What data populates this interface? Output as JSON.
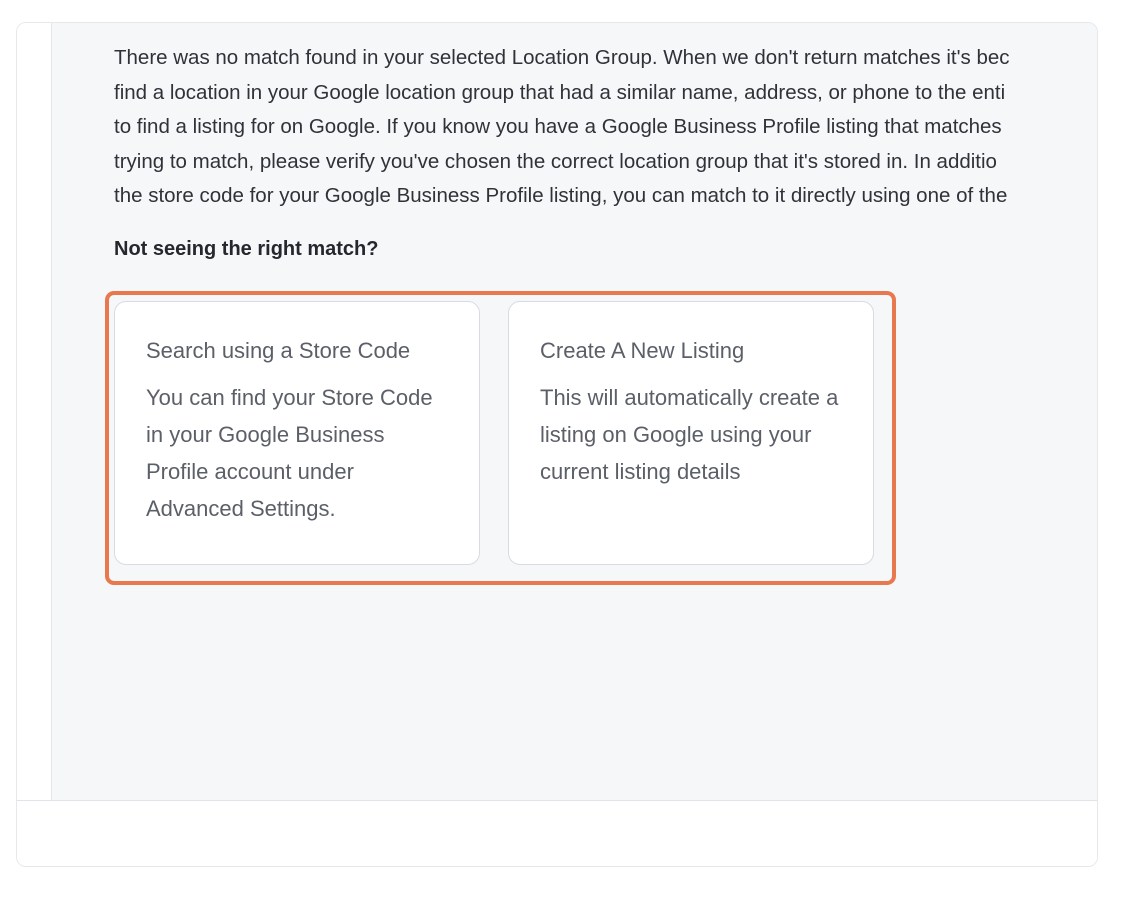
{
  "intro": {
    "lines": [
      "There was no match found in your selected Location Group. When we don't return matches it's bec",
      "find a location in your Google location group that had a similar name, address, or phone to the enti",
      "to find a listing for on Google. If you know you have a Google Business Profile listing that matches",
      "trying to match, please verify you've chosen the correct location group that it's stored in. In additio",
      "the store code for your Google Business Profile listing, you can match to it directly using one of the"
    ]
  },
  "prompt": {
    "heading": "Not seeing the right match?"
  },
  "options": [
    {
      "title": "Search using a Store Code",
      "description": "You can find your Store Code in your Google Business Profile account under Advanced Settings."
    },
    {
      "title": "Create A New Listing",
      "description": "This will automatically create a listing on Google using your current listing details"
    }
  ],
  "colors": {
    "highlight": "#e8794f",
    "panel": "#f6f7f9",
    "text": "#2f3238",
    "muted_text": "#5b5f67"
  }
}
